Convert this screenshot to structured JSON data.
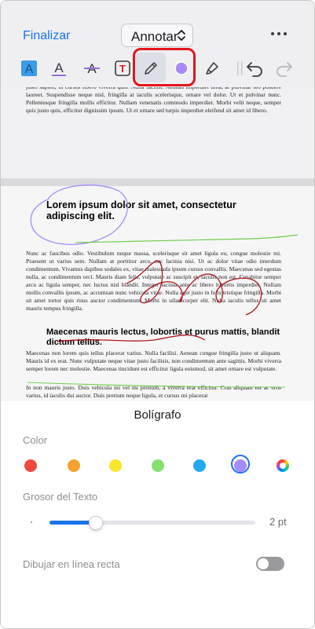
{
  "toolbar": {
    "finish_label": "Finalizar",
    "mode_label": "Annotar",
    "tools": [
      {
        "icon": "text-highlight-icon"
      },
      {
        "icon": "text-underline-icon"
      },
      {
        "icon": "text-strikethrough-icon"
      },
      {
        "icon": "text-box-icon"
      },
      {
        "icon": "pen-icon",
        "active": true
      },
      {
        "icon": "color-picker-icon",
        "color": "#a78bfa"
      },
      {
        "icon": "marker-icon"
      },
      {
        "icon": "undo-icon"
      },
      {
        "icon": "redo-icon"
      }
    ]
  },
  "document": {
    "page1_text": "justo sapien, in cursus libero viverra quis. Nulla facilisi. Aenean imperdiet urna, at pulvinar leo posuere laoreet. Suspendisse neque nisl, fringilla at iaculis scelerisque, ornare vel dolor. Ut et pulvinar nunc. Pellentesque fringilla mollis efficitur. Nullam venenatis commodo imperdiet. Morbi velit neque, semper quis justo quis, efficitur dignissim ipsum. Ut et ornare sed turpis imperdiet eleifend sit amet id libero.",
    "heading1": "Lorem ipsum dolor sit amet, consectetur adipiscing elit.",
    "para1": "Nunc ac faucibus odio. Vestibulum neque massa, scelerisque sit amet ligula eu, congue molestie mi. Praesent ut varius sem. Nullam at porttitor arcu, nec lacinia nisi. Ut ac dolor vitae odio interdum condimentum. Vivamus dapibus sodales ex, vitae malesuada ipsum cursus convallis. Maecenas sed egestas nulla, ac condimentum orci. Mauris diam felis, vulputate ac suscipit et, iaculis non est. Curabitur semper arcu ac ligula semper, nec luctus nisl blandit. Integer lacinia ante ac libero lobortis imperdiet. Nullam mollis convallis ipsum, ac accumsan nunc vehicula vitae. Nulla eget justo in felis tristique fringilla. Morbi sit amet tortor quis risus auctor condimentum. Morbi in ullamcorper elit. Nulla iaculis tellus sit amet mauris tempus fringilla.",
    "heading2": "Maecenas mauris lectus, lobortis et purus mattis, blandit dictum tellus.",
    "para2": "Maecenas non lorem quis tellus placerat varius. Nulla facilisi. Aenean congue fringilla justo ut aliquam. Mauris id ex erat. Nunc vulputate neque vitae justo facilisis, non condimentum ante sagittis. Morbi viverra semper lorem nec molestie. Maecenas tincidunt est efficitur ligula euismod, sit amet ornare est vulputate.",
    "para3": "In non mauris justo. Duis vehicula mi vel mi pretium, a viverra erat efficitur. Cras aliquam est ac eros varius, id iaculis dui auctor. Duis pretium neque ligula, et cursus mi placerat"
  },
  "panel": {
    "title": "Bolígrafo",
    "color_label": "Color",
    "colors": [
      {
        "name": "red",
        "hex": "#f04a3e"
      },
      {
        "name": "orange",
        "hex": "#f3a22b"
      },
      {
        "name": "yellow",
        "hex": "#f7e62c"
      },
      {
        "name": "green",
        "hex": "#86e070"
      },
      {
        "name": "blue",
        "hex": "#24a8f0"
      },
      {
        "name": "purple",
        "hex": "#a78bfa",
        "selected": true
      },
      {
        "name": "custom-color-wheel"
      }
    ],
    "size_label": "Grosor del Texto",
    "size_fraction": 0.22,
    "size_value": "2 pt",
    "straight_line_label": "Dibujar en línea recta",
    "straight_line_on": false
  },
  "colors": {
    "accent": "#1a73e8",
    "highlight_box": "#e4151b",
    "ink_purple": "#a78bfa",
    "ink_red": "#b0161f",
    "ink_green": "#6fcf4b"
  }
}
